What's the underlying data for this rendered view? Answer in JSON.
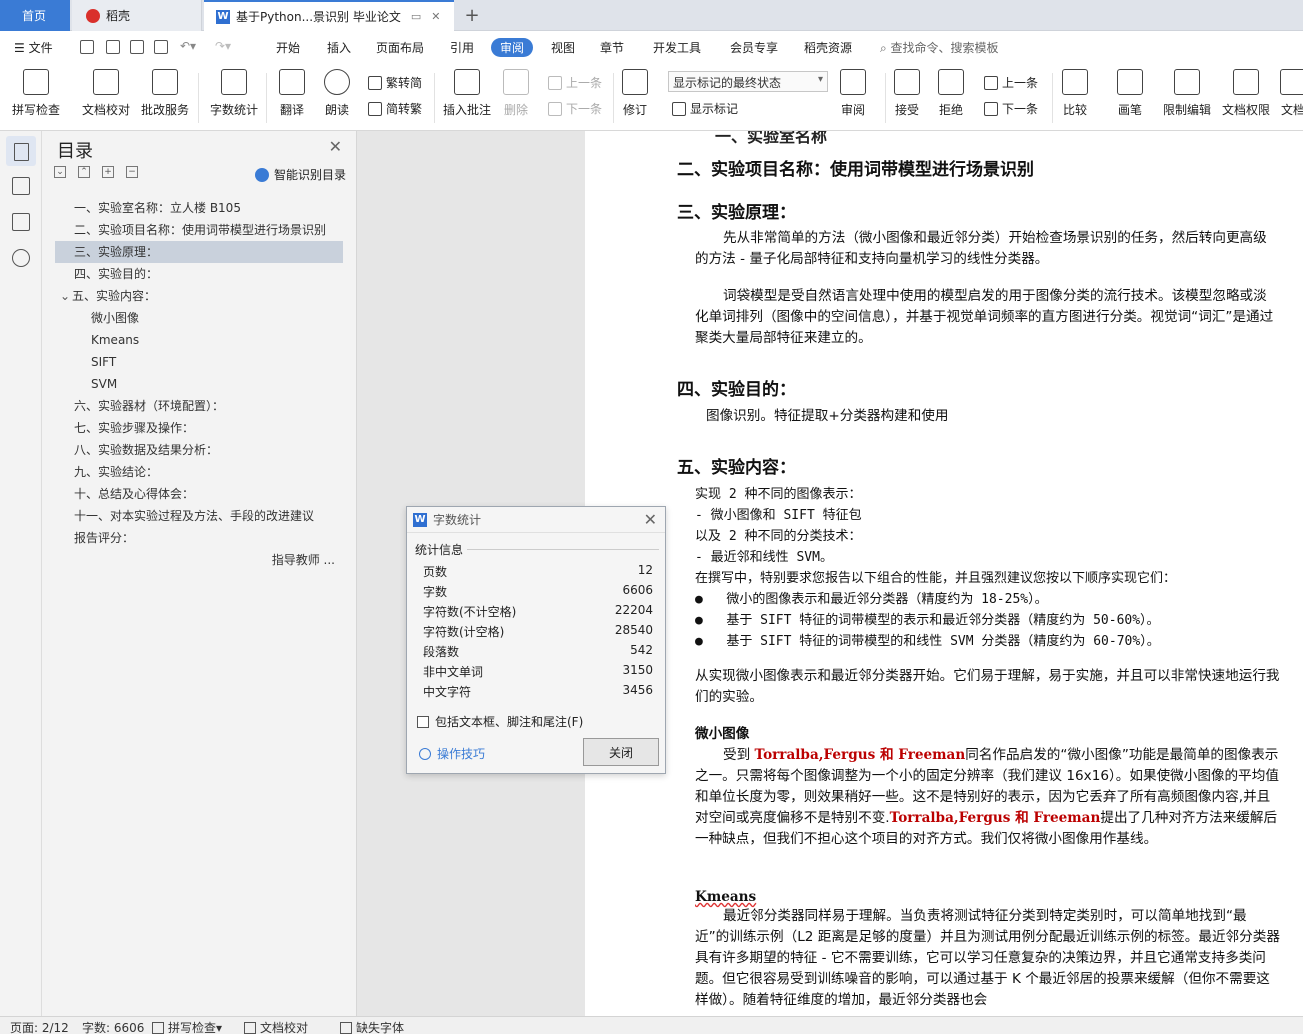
{
  "tabs": {
    "home": "首页",
    "daoke": "稻壳",
    "doc": "基于Python...景识别 毕业论文"
  },
  "menu": {
    "file": "文件",
    "items": [
      "开始",
      "插入",
      "页面布局",
      "引用",
      "审阅",
      "视图",
      "章节",
      "开发工具",
      "会员专享",
      "稻壳资源"
    ],
    "active_index": 4,
    "search": "查找命令、搜索模板"
  },
  "ribbon": {
    "spell_check": "拼写检查",
    "doc_proof": "文档校对",
    "batch_service": "批改服务",
    "word_count": "字数统计",
    "translate": "翻译",
    "read_aloud": "朗读",
    "trad": "繁转简",
    "simp": "简转繁",
    "insert_comment": "插入批注",
    "delete": "删除",
    "prev": "上一条",
    "next": "下一条",
    "revise": "修订",
    "display_mode": "显示标记的最终状态",
    "show_marks": "显示标记",
    "review": "审阅",
    "accept": "接受",
    "reject": "拒绝",
    "prev2": "上一条",
    "next2": "下一条",
    "compare": "比较",
    "pen": "画笔",
    "restrict": "限制编辑",
    "doc_perm": "文档权限",
    "more": "文档"
  },
  "toc": {
    "title": "目录",
    "smart": "智能识别目录",
    "items": [
      {
        "text": "一、实验室名称：立人楼 B105",
        "level": 1
      },
      {
        "text": "二、实验项目名称：使用词带模型进行场景识别",
        "level": 1
      },
      {
        "text": "三、实验原理：",
        "level": 1,
        "active": true
      },
      {
        "text": "四、实验目的：",
        "level": 1
      },
      {
        "text": "五、实验内容：",
        "level": 1,
        "expanded": true
      },
      {
        "text": "微小图像",
        "level": 2
      },
      {
        "text": "Kmeans",
        "level": 2
      },
      {
        "text": "SIFT",
        "level": 2
      },
      {
        "text": "SVM",
        "level": 2
      },
      {
        "text": "六、实验器材（环境配置）：",
        "level": 1
      },
      {
        "text": "七、实验步骤及操作：",
        "level": 1
      },
      {
        "text": "八、实验数据及结果分析：",
        "level": 1
      },
      {
        "text": "九、实验结论：",
        "level": 1
      },
      {
        "text": "十、总结及心得体会：",
        "level": 1
      },
      {
        "text": "十一、对本实验过程及方法、手段的改进建议",
        "level": 1
      },
      {
        "text": "报告评分：",
        "level": 1
      },
      {
        "text": "指导教师 ...",
        "level": 3
      }
    ]
  },
  "document": {
    "h2": "二、实验项目名称：使用词带模型进行场景识别",
    "h3": "三、实验原理：",
    "p1": "先从非常简单的方法（微小图像和最近邻分类）开始检查场景识别的任务，然后转向更高级的方法 - 量子化局部特征和支持向量机学习的线性分类器。",
    "p2": "词袋模型是受自然语言处理中使用的模型启发的用于图像分类的流行技术。该模型忽略或淡化单词排列（图像中的空间信息），并基于视觉单词频率的直方图进行分类。视觉词“词汇”是通过聚类大量局部特征来建立的。",
    "h4": "四、实验目的：",
    "p3": "图像识别。特征提取+分类器构建和使用",
    "h5": "五、实验内容：",
    "l1": "实现 2 种不同的图像表示：",
    "l2": "-    微小图像和 SIFT 特征包",
    "l3": "以及 2 种不同的分类技术：",
    "l4": "-    最近邻和线性 SVM。",
    "l5": "在撰写中，特别要求您报告以下组合的性能，并且强烈建议您按以下顺序实现它们：",
    "b1": "微小的图像表示和最近邻分类器（精度约为 18-25%）。",
    "b2": "基于 SIFT 特征的词带模型的表示和最近邻分类器（精度约为 50-60%）。",
    "b3": "基于 SIFT 特征的词带模型的和线性 SVM 分类器（精度约为 60-70%）。",
    "p4": "从实现微小图像表示和最近邻分类器开始。它们易于理解，易于实施，并且可以非常快速地运行我们的实验。",
    "s1": "微小图像",
    "p5a": "受到 ",
    "p5red": "Torralba,Fergus 和 Freeman",
    "p5b": "同名作品启发的“微小图像”功能是最简单的图像表示之一。只需将每个图像调整为一个小的固定分辨率（我们建议 16x16）。如果使微小图像的平均值和单位长度为零，则效果稍好一些。这不是特别好的表示，因为它丢弃了所有高频图像内容,并且对空间或亮度偏移不是特别不变.",
    "p5red2": "Torralba,Fergus 和 Freeman",
    "p5c": "提出了几种对齐方法来缓解后一种缺点，但我们不担心这个项目的对齐方式。我们仅将微小图像用作基线。",
    "s2": "Kmeans",
    "p6": "最近邻分类器同样易于理解。当负责将测试特征分类到特定类别时，可以简单地找到“最近”的训练示例（L2 距离是足够的度量）并且为测试用例分配最近训练示例的标签。最近邻分类器具有许多期望的特征 - 它不需要训练，它可以学习任意复杂的决策边界，并且它通常支持多类问题。但它很容易受到训练噪音的影响，可以通过基于 K 个最近邻居的投票来缓解（但你不需要这样做）。随着特征维度的增加，最近邻分类器也会"
  },
  "dialog": {
    "title": "字数统计",
    "group": "统计信息",
    "stats": [
      {
        "label": "页数",
        "value": "12"
      },
      {
        "label": "字数",
        "value": "6606"
      },
      {
        "label": "字符数(不计空格)",
        "value": "22204"
      },
      {
        "label": "字符数(计空格)",
        "value": "28540"
      },
      {
        "label": "段落数",
        "value": "542"
      },
      {
        "label": "非中文单词",
        "value": "3150"
      },
      {
        "label": "中文字符",
        "value": "3456"
      }
    ],
    "include": "包括文本框、脚注和尾注(F)",
    "tips": "操作技巧",
    "close": "关闭"
  },
  "status": {
    "page": "页面: 2/12",
    "words": "字数: 6606",
    "spell": "拼写检查",
    "proof": "文档校对",
    "font": "缺失字体"
  }
}
